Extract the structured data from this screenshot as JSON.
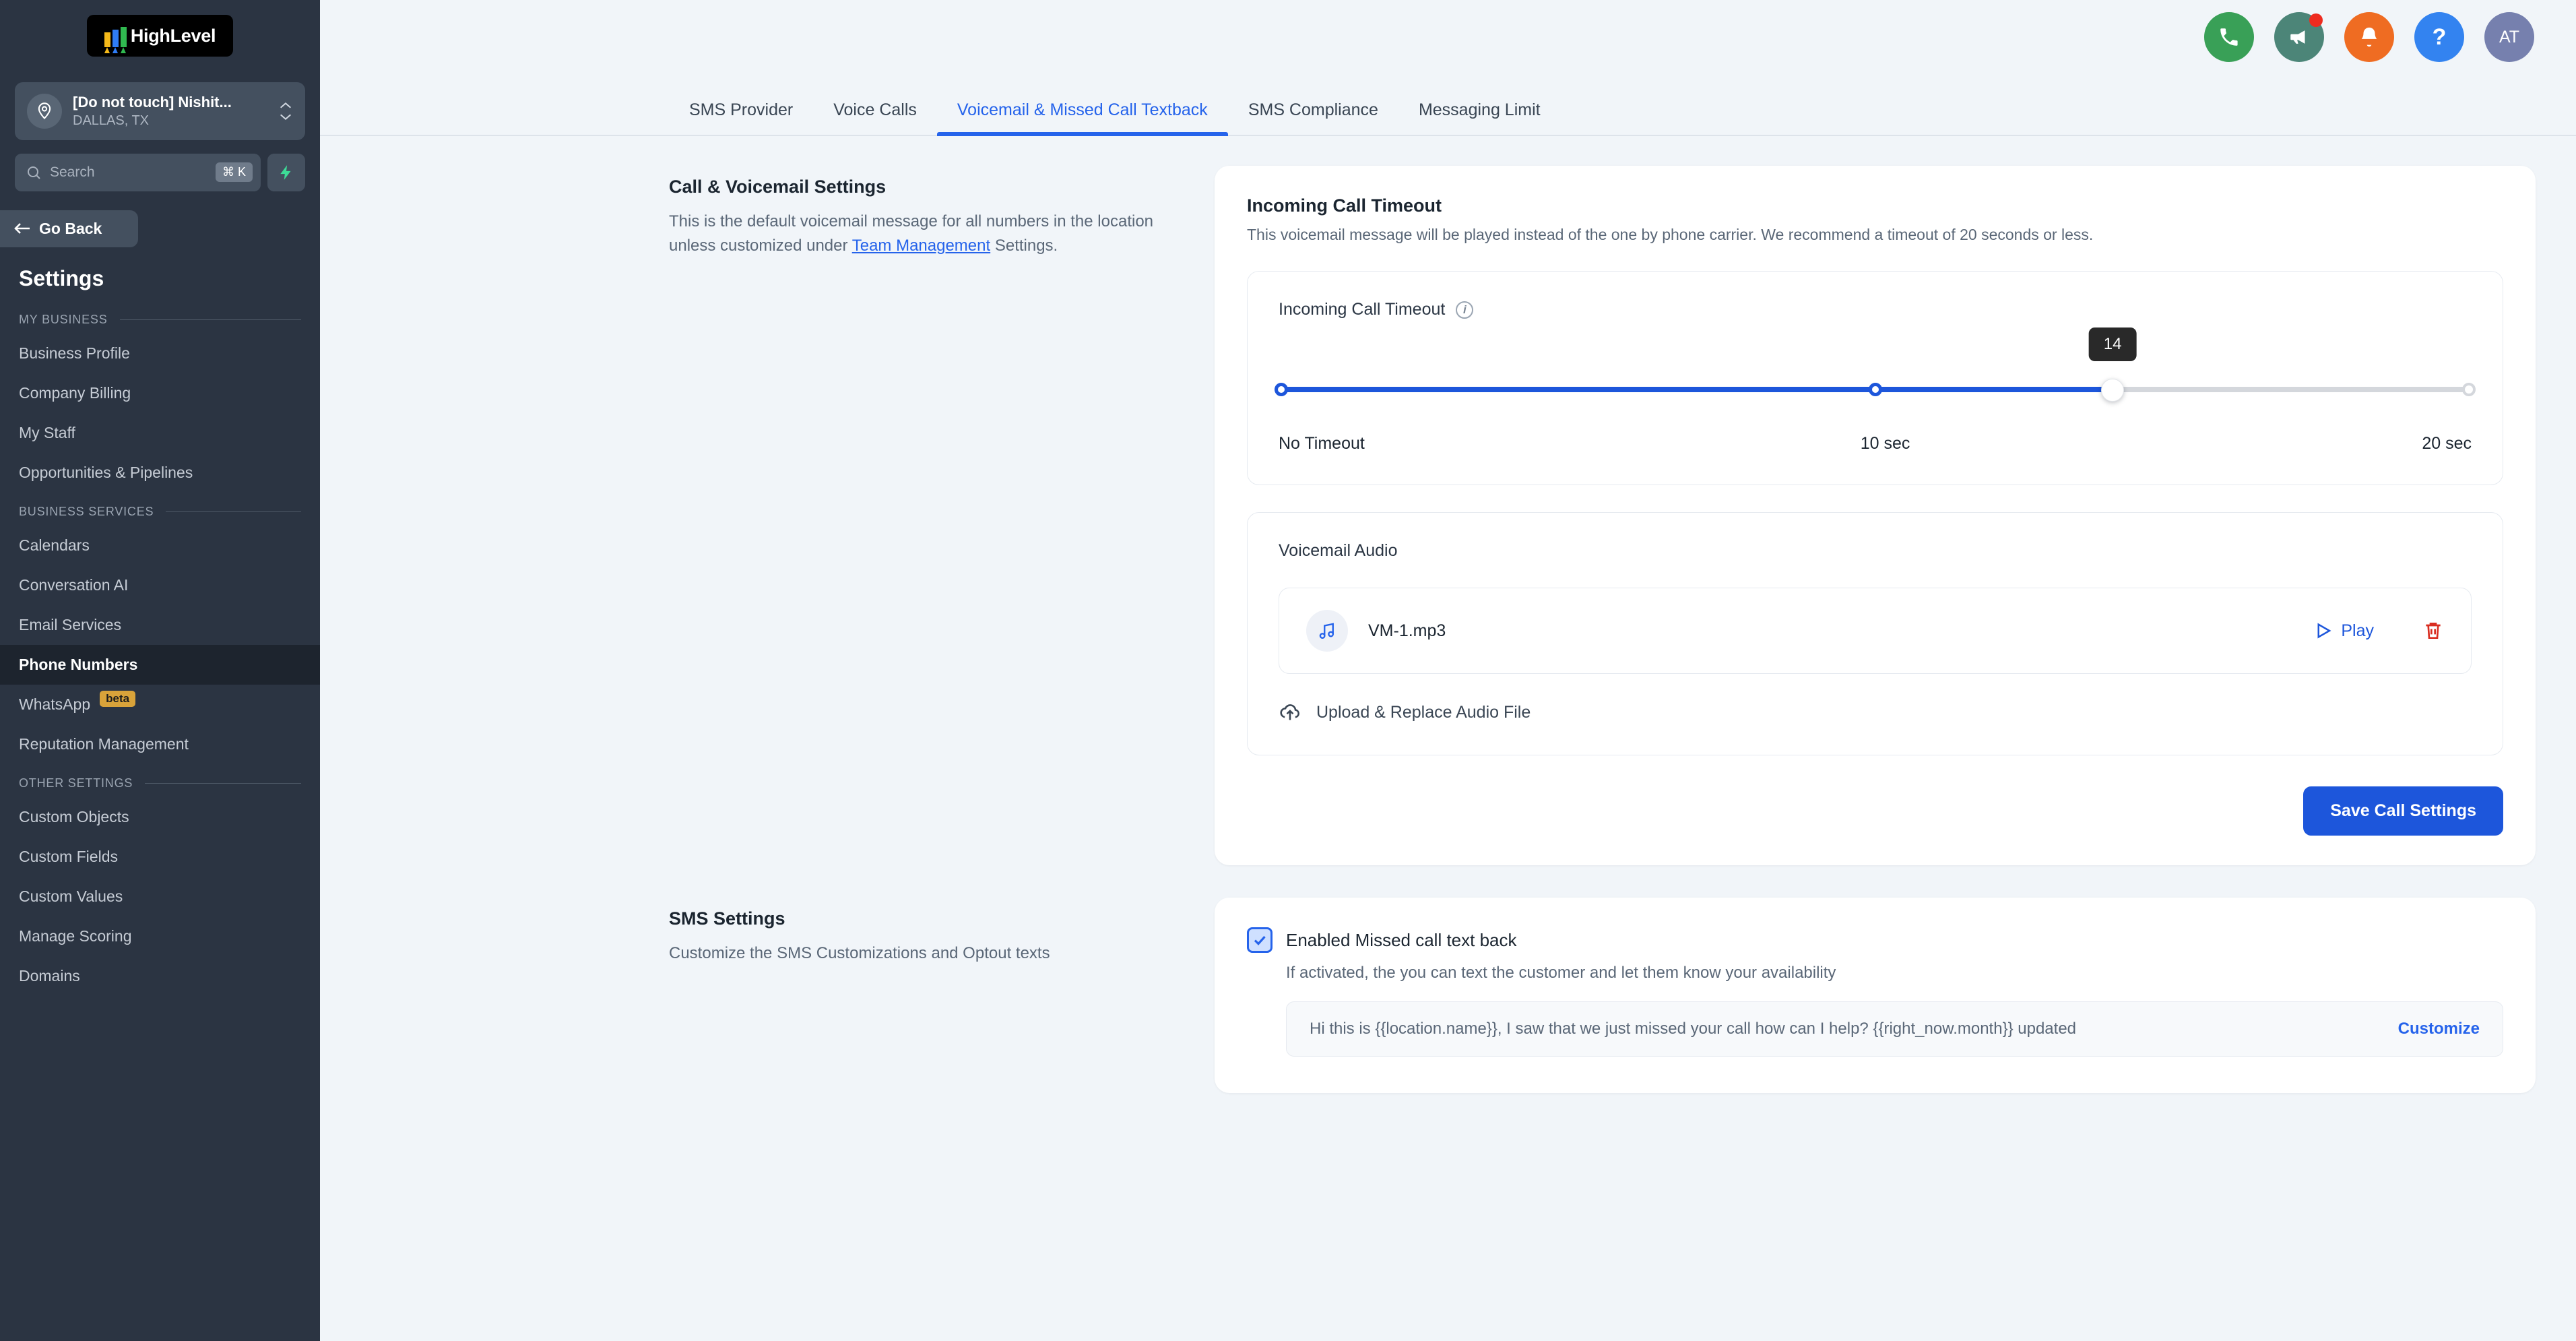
{
  "brand": {
    "name": "HighLevel",
    "logo_colors": [
      "#f5b919",
      "#2f7df6",
      "#30b950"
    ]
  },
  "sidebar": {
    "location": {
      "name": "[Do not touch] Nishit...",
      "sub": "DALLAS, TX",
      "icon": "map-pin-icon"
    },
    "search": {
      "placeholder": "Search",
      "shortcut": "⌘ K",
      "quick_action_icon": "bolt-icon"
    },
    "go_back": "Go Back",
    "title": "Settings",
    "sections": [
      {
        "label": "MY BUSINESS",
        "items": [
          {
            "label": "Business Profile",
            "active": false
          },
          {
            "label": "Company Billing",
            "active": false
          },
          {
            "label": "My Staff",
            "active": false
          },
          {
            "label": "Opportunities & Pipelines",
            "active": false
          }
        ]
      },
      {
        "label": "BUSINESS SERVICES",
        "items": [
          {
            "label": "Calendars",
            "active": false
          },
          {
            "label": "Conversation AI",
            "active": false
          },
          {
            "label": "Email Services",
            "active": false
          },
          {
            "label": "Phone Numbers",
            "active": true
          },
          {
            "label": "WhatsApp",
            "active": false,
            "badge": "beta"
          },
          {
            "label": "Reputation Management",
            "active": false
          }
        ]
      },
      {
        "label": "OTHER SETTINGS",
        "items": [
          {
            "label": "Custom Objects",
            "active": false
          },
          {
            "label": "Custom Fields",
            "active": false
          },
          {
            "label": "Custom Values",
            "active": false
          },
          {
            "label": "Manage Scoring",
            "active": false
          },
          {
            "label": "Domains",
            "active": false
          }
        ]
      }
    ]
  },
  "topbar": {
    "icons": [
      {
        "name": "phone-icon",
        "color": "#39a057"
      },
      {
        "name": "megaphone-icon",
        "color": "#4c8578",
        "badge": true
      },
      {
        "name": "bell-icon",
        "color": "#ef6c22"
      },
      {
        "name": "help-icon",
        "color": "#3383f0",
        "glyph": "?"
      }
    ],
    "avatar": {
      "initials": "AT",
      "color": "#7680ae"
    }
  },
  "tabs": [
    {
      "label": "SMS Provider",
      "active": false
    },
    {
      "label": "Voice Calls",
      "active": false
    },
    {
      "label": "Voicemail & Missed Call Textback",
      "active": true
    },
    {
      "label": "SMS Compliance",
      "active": false
    },
    {
      "label": "Messaging Limit",
      "active": false
    }
  ],
  "call_section": {
    "heading": "Call & Voicemail Settings",
    "desc_before": "This is the default voicemail message for all numbers in the location unless customized under ",
    "desc_link": "Team Management",
    "desc_after": " Settings.",
    "panel_title": "Incoming Call Timeout",
    "panel_sub": "This voicemail message will be played instead of the one by phone carrier. We recommend a timeout of 20 seconds or less.",
    "slider": {
      "label": "Incoming Call Timeout",
      "value": "14",
      "min_label": "No Timeout",
      "mid_label": "10 sec",
      "max_label": "20 sec",
      "min": 0,
      "mid": 10,
      "max": 20,
      "fill_color": "#1d56db",
      "track_color": "#d4d7dc"
    },
    "audio": {
      "title": "Voicemail Audio",
      "file_name": "VM-1.mp3",
      "file_icon": "music-note-icon",
      "play_label": "Play",
      "delete_icon": "trash-icon",
      "delete_color": "#d92d20",
      "upload_label": "Upload & Replace Audio File",
      "upload_icon": "upload-cloud-icon"
    },
    "save_label": "Save Call Settings"
  },
  "sms_section": {
    "heading": "SMS Settings",
    "desc": "Customize the SMS Customizations and Optout texts",
    "checkbox_label": "Enabled Missed call text back",
    "checkbox_checked": true,
    "help": "If activated, the you can text the customer and let them know your availability",
    "message_value": "Hi this is {{location.name}}, I saw that we just missed your call how can I help? {{right_now.month}} updated",
    "customize_label": "Customize"
  }
}
